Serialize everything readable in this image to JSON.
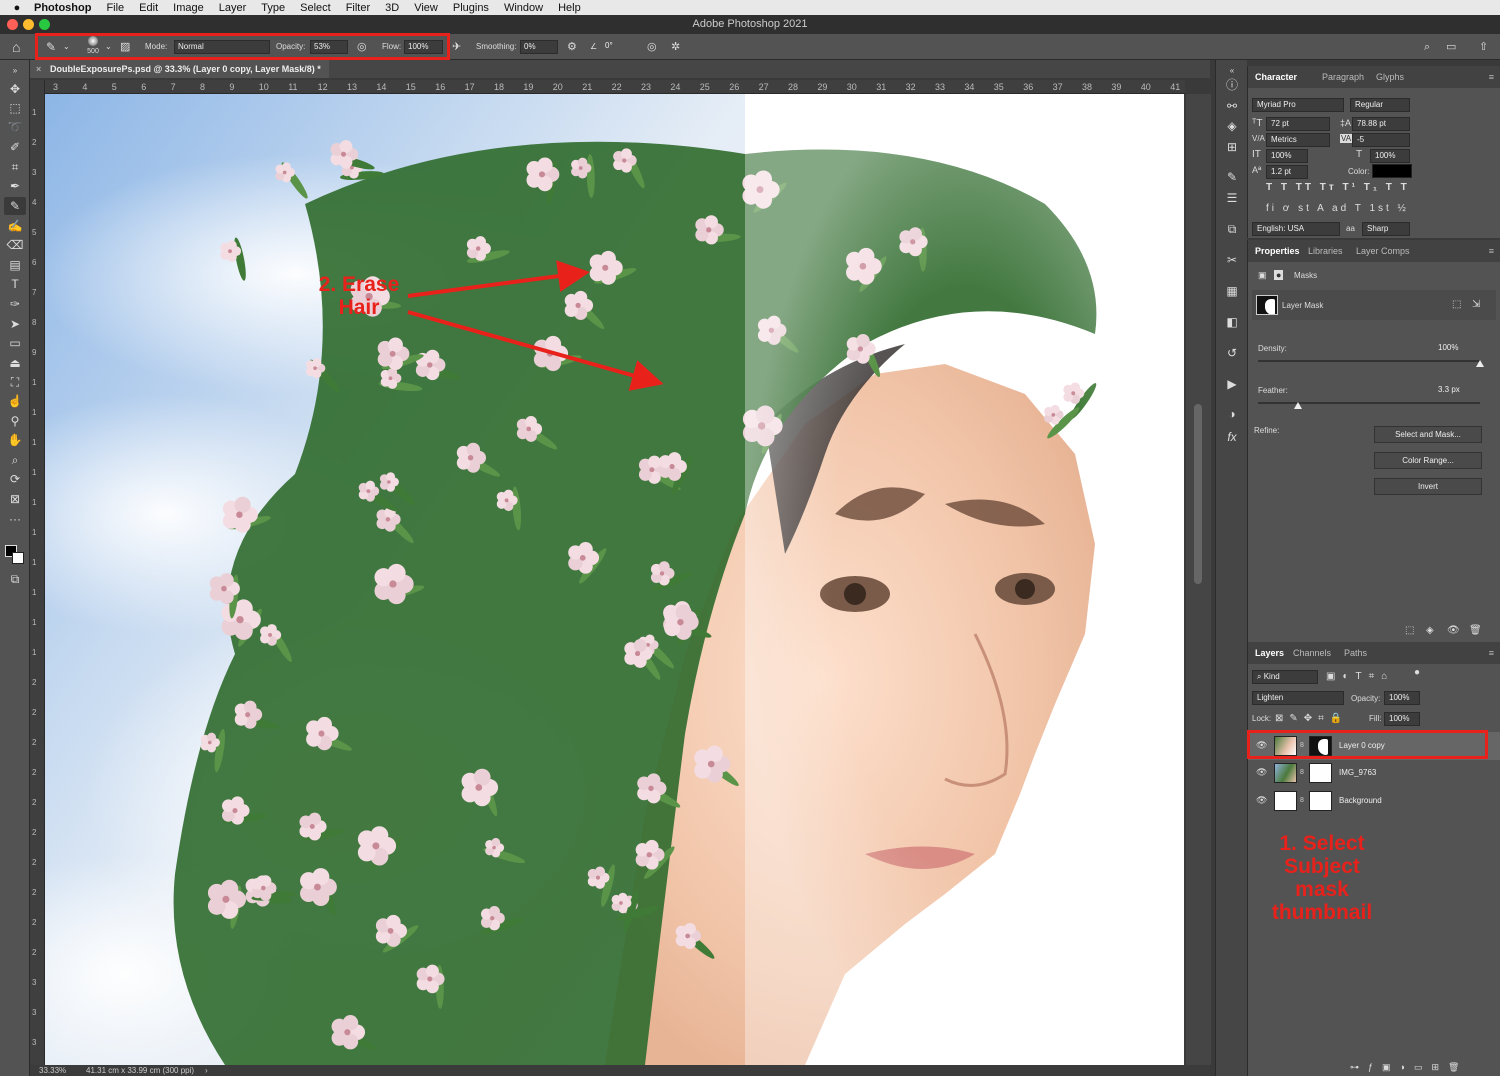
{
  "menubar": {
    "app_name": "Photoshop",
    "items": [
      "File",
      "Edit",
      "Image",
      "Layer",
      "Type",
      "Select",
      "Filter",
      "3D",
      "View",
      "Plugins",
      "Window",
      "Help"
    ]
  },
  "window": {
    "title": "Adobe Photoshop 2021"
  },
  "options_bar": {
    "brush_size": "500",
    "mode_label": "Mode:",
    "mode_value": "Normal",
    "opacity_label": "Opacity:",
    "opacity_value": "53%",
    "flow_label": "Flow:",
    "flow_value": "100%",
    "smoothing_label": "Smoothing:",
    "smoothing_value": "0%",
    "angle_value": "0°"
  },
  "document": {
    "tab_title": "DoubleExposurePs.psd @ 33.3% (Layer 0 copy, Layer Mask/8) *",
    "zoom": "33.33%",
    "doc_size": "41.31 cm x 33.99 cm (300 ppi)"
  },
  "ruler_h": [
    "3",
    "4",
    "5",
    "6",
    "7",
    "8",
    "9",
    "10",
    "11",
    "12",
    "13",
    "14",
    "15",
    "16",
    "17",
    "18",
    "19",
    "20",
    "21",
    "22",
    "23",
    "24",
    "25",
    "26",
    "27",
    "28",
    "29",
    "30",
    "31",
    "32",
    "33",
    "34",
    "35",
    "36",
    "37",
    "38",
    "39",
    "40",
    "41"
  ],
  "ruler_v": [
    "1",
    "2",
    "3",
    "4",
    "5",
    "6",
    "7",
    "8",
    "9",
    "1",
    "1",
    "1",
    "1",
    "1",
    "1",
    "1",
    "1",
    "1",
    "1",
    "2",
    "2",
    "2",
    "2",
    "2",
    "2",
    "2",
    "2",
    "2",
    "2",
    "3",
    "3",
    "3"
  ],
  "character_panel": {
    "tabs": [
      "Character",
      "Paragraph",
      "Glyphs"
    ],
    "font_family": "Myriad Pro",
    "font_style": "Regular",
    "font_size": "72 pt",
    "leading": "78.88 pt",
    "kerning": "Metrics",
    "tracking": "-5",
    "vscale": "100%",
    "hscale": "100%",
    "baseline": "1.2 pt",
    "color_label": "Color:",
    "language": "English: USA",
    "aa_label": "aa",
    "antialias": "Sharp",
    "typo_buttons": [
      "T",
      "T",
      "TT",
      "Tт",
      "T¹",
      "T₁",
      "T",
      "T"
    ],
    "ot_buttons": [
      "fi",
      "ơ",
      "st",
      "A",
      "ad",
      "T",
      "1st",
      "½"
    ]
  },
  "properties_panel": {
    "tabs": [
      "Properties",
      "Libraries",
      "Layer Comps"
    ],
    "section": "Masks",
    "mask_label": "Layer Mask",
    "density_label": "Density:",
    "density_value": "100%",
    "density_level": 1.0,
    "feather_label": "Feather:",
    "feather_value": "3.3 px",
    "feather_level": 0.18,
    "refine_label": "Refine:",
    "buttons": [
      "Select and Mask...",
      "Color Range...",
      "Invert"
    ]
  },
  "layers_panel": {
    "tabs": [
      "Layers",
      "Channels",
      "Paths"
    ],
    "filter_label": "Kind",
    "blend_mode": "Lighten",
    "opacity_label": "Opacity:",
    "opacity_value": "100%",
    "lock_label": "Lock:",
    "fill_label": "Fill:",
    "fill_value": "100%",
    "layers": [
      {
        "name": "Layer 0 copy",
        "selected": true
      },
      {
        "name": "IMG_9763",
        "selected": false
      },
      {
        "name": "Background",
        "selected": false
      }
    ]
  },
  "annotations": {
    "erase_hair": [
      "2. Erase",
      "Hair"
    ],
    "select_subject": [
      "1. Select",
      "Subject",
      "mask",
      "thumbnail"
    ],
    "color": "#e8211b"
  }
}
